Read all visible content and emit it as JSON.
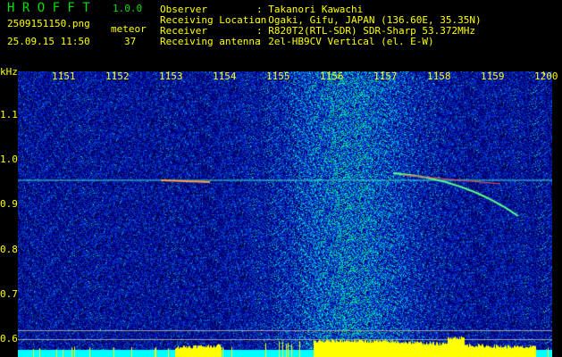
{
  "app": {
    "name": "H R O F F T",
    "version": "1.0.0"
  },
  "file": {
    "name": "2509151150.png",
    "datetime": "25.09.15 11:50"
  },
  "meteor": {
    "label": "meteor",
    "count": "37"
  },
  "info": [
    {
      "label": "Observer",
      "value": ": Takanori Kawachi"
    },
    {
      "label": "Receiving Location",
      "value": ": Ogaki, Gifu, JAPAN (136.60E, 35.35N)"
    },
    {
      "label": "Receiver",
      "value": ": R820T2(RTL-SDR) SDR-Sharp 53.372MHz"
    },
    {
      "label": "Receiving antenna",
      "value": ": 2el-HB9CV Vertical (el. E-W)"
    }
  ],
  "axis": {
    "unit": "kHz",
    "y_ticks": [
      "1.1",
      "1.0",
      "0.9",
      "0.8",
      "0.7",
      "0.6"
    ],
    "x_ticks": [
      "1151",
      "1152",
      "1153",
      "1154",
      "1155",
      "1156",
      "1157",
      "1158",
      "1159",
      "1200"
    ]
  },
  "colors": {
    "text": "#ffff00",
    "title": "#00e000",
    "bg": "#000000"
  }
}
